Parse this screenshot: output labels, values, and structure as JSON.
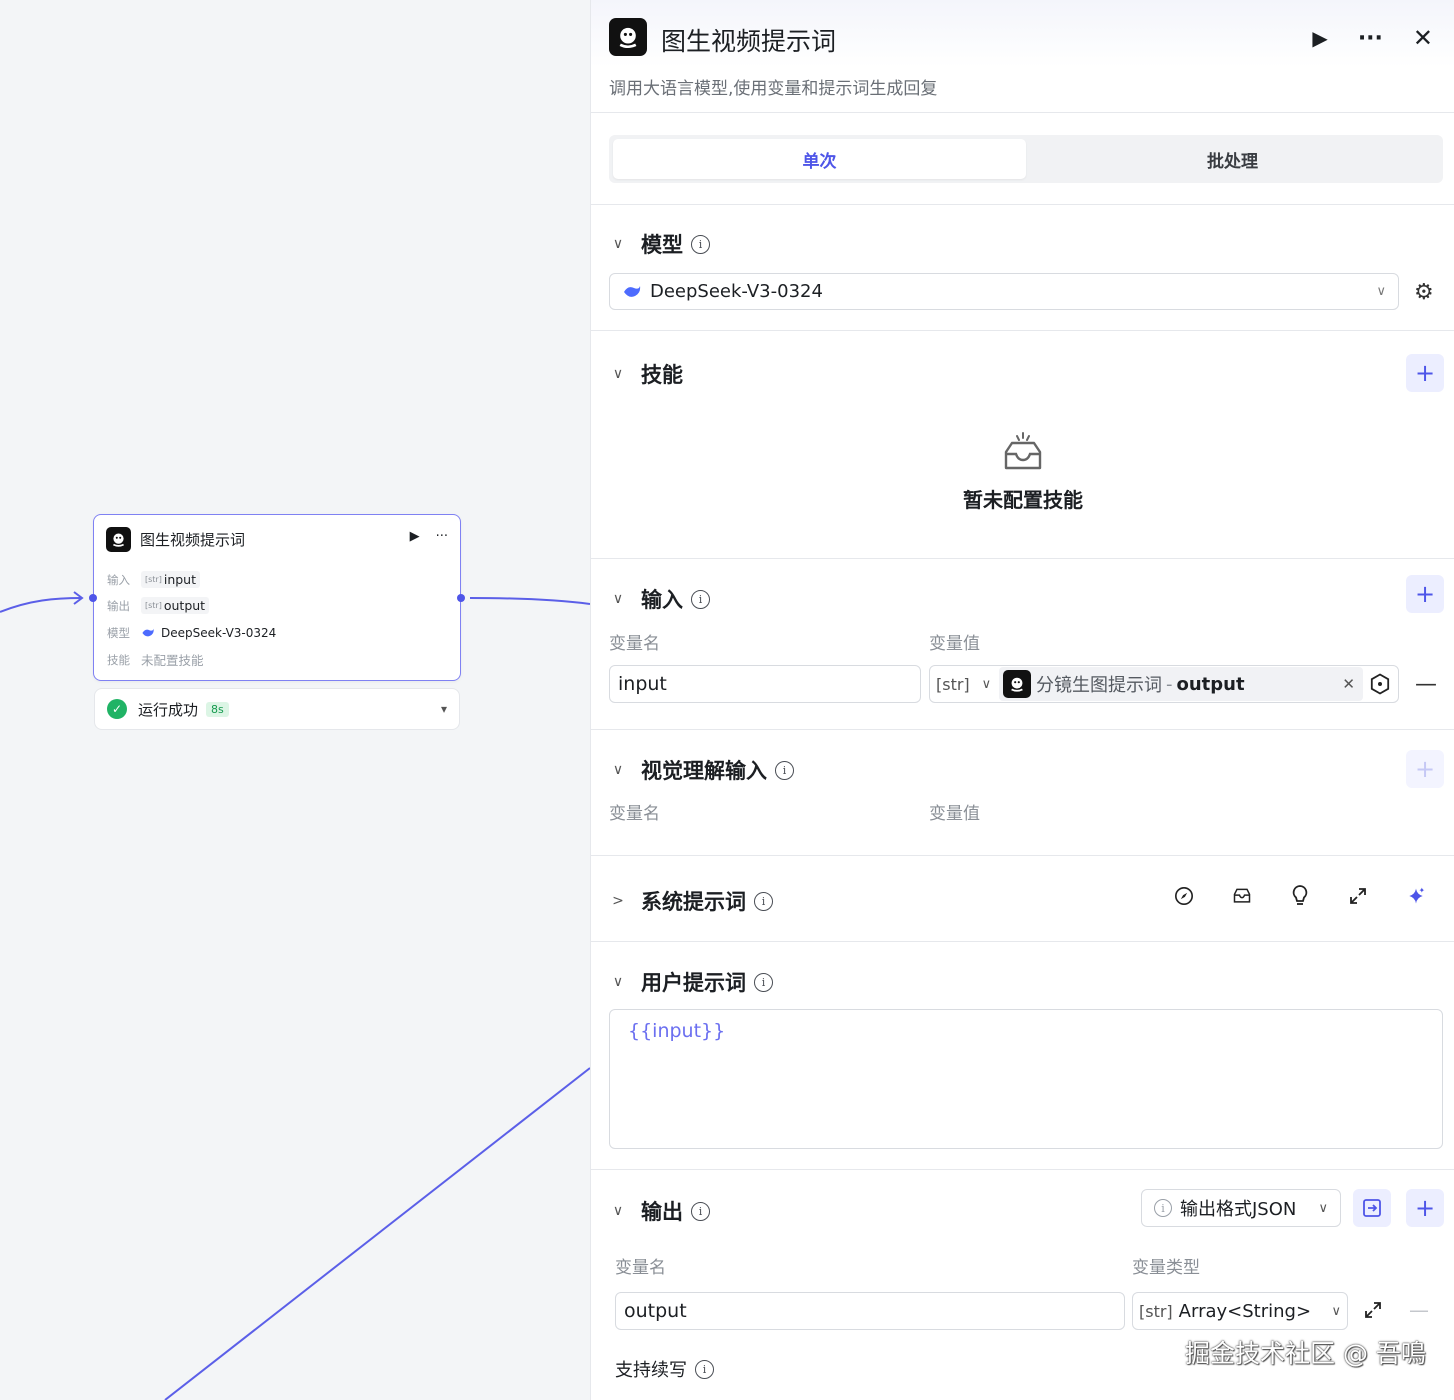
{
  "node": {
    "title": "图生视频提示词",
    "rows": [
      {
        "label": "输入",
        "type_tag": "[str]",
        "value": "input"
      },
      {
        "label": "输出",
        "type_tag": "[str]",
        "value": "output"
      },
      {
        "label": "模型",
        "value": "DeepSeek-V3-0324"
      },
      {
        "label": "技能",
        "value": "未配置技能"
      }
    ],
    "run_status": "运行成功",
    "run_time": "8s"
  },
  "panel": {
    "title": "图生视频提示词",
    "description": "调用大语言模型,使用变量和提示词生成回复",
    "tabs": [
      {
        "label": "单次",
        "active": true
      },
      {
        "label": "批处理",
        "active": false
      }
    ],
    "model_section": {
      "title": "模型",
      "selected_model": "DeepSeek-V3-0324"
    },
    "skills_section": {
      "title": "技能",
      "empty_text": "暂未配置技能"
    },
    "input_section": {
      "title": "输入",
      "col_name": "变量名",
      "col_value": "变量值",
      "row": {
        "name": "input",
        "type": "[str]",
        "ref_node": "分镜生图提示词",
        "ref_sep": "-",
        "ref_var": "output"
      }
    },
    "vision_section": {
      "title": "视觉理解输入",
      "col_name": "变量名",
      "col_value": "变量值"
    },
    "system_prompt_section": {
      "title": "系统提示词"
    },
    "user_prompt_section": {
      "title": "用户提示词",
      "content": "{{input}}"
    },
    "output_section": {
      "title": "输出",
      "format_label": "输出格式JSON",
      "col_name": "变量名",
      "col_type": "变量类型",
      "row": {
        "name": "output",
        "type_tag": "[str]",
        "type": "Array<String>"
      },
      "continue_label": "支持续写"
    }
  },
  "watermark": "掘金技术社区 @ 吾鳴",
  "colors": {
    "accent": "#4e55e8",
    "success": "#20b365",
    "edge": "#5b5fe8"
  }
}
